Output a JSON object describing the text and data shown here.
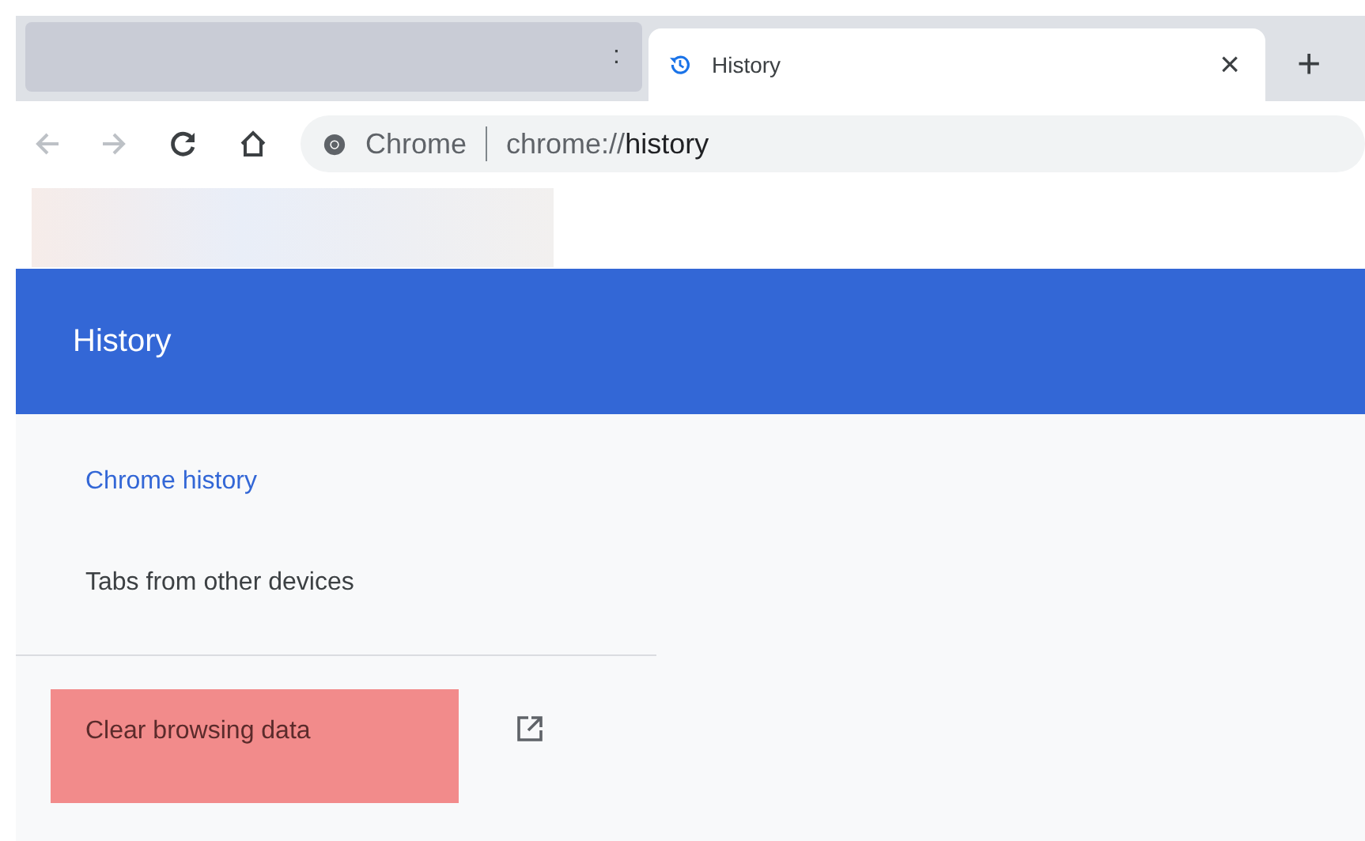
{
  "tabs": [
    {
      "kind": "blurred",
      "label": ":",
      "selected": false
    },
    {
      "kind": "page",
      "label": "History",
      "selected": true
    }
  ],
  "new_tab": "+",
  "close_tab": "×",
  "omnibox": {
    "site_label": "Chrome",
    "url": "chrome://**history**"
  },
  "header": {
    "title": "History"
  },
  "sidebar": {
    "items": [
      {
        "label": "Chrome history",
        "selected": true,
        "highlighted": false
      },
      {
        "label": "Tabs from other devices",
        "selected": false,
        "highlighted": false
      }
    ],
    "footer_items": [
      {
        "label": "Clear browsing data",
        "selected": false,
        "kind": "external",
        "highlighted": true
      }
    ]
  }
}
